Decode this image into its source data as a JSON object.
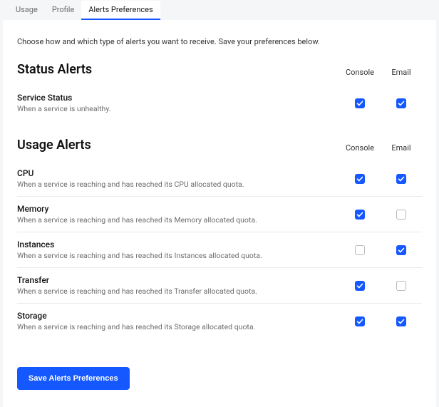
{
  "tabs": {
    "usage": "Usage",
    "profile": "Profile",
    "alerts_preferences": "Alerts Preferences",
    "active": "alerts_preferences"
  },
  "intro": "Choose how and which type of alerts you want to receive. Save your preferences below.",
  "columns": {
    "console": "Console",
    "email": "Email"
  },
  "sections": {
    "status": {
      "title": "Status Alerts",
      "rows": {
        "service_status": {
          "title": "Service Status",
          "desc": "When a service is unhealthy.",
          "console": true,
          "email": true
        }
      }
    },
    "usage": {
      "title": "Usage Alerts",
      "rows": {
        "cpu": {
          "title": "CPU",
          "desc": "When a service is reaching and has reached its CPU allocated quota.",
          "console": true,
          "email": true
        },
        "memory": {
          "title": "Memory",
          "desc": "When a service is reaching and has reached its Memory allocated quota.",
          "console": true,
          "email": false
        },
        "instances": {
          "title": "Instances",
          "desc": "When a service is reaching and has reached its Instances allocated quota.",
          "console": false,
          "email": true
        },
        "transfer": {
          "title": "Transfer",
          "desc": "When a service is reaching and has reached its Transfer allocated quota.",
          "console": true,
          "email": false
        },
        "storage": {
          "title": "Storage",
          "desc": "When a service is reaching and has reached its Storage allocated quota.",
          "console": true,
          "email": true
        }
      }
    }
  },
  "save_button": "Save Alerts Preferences"
}
